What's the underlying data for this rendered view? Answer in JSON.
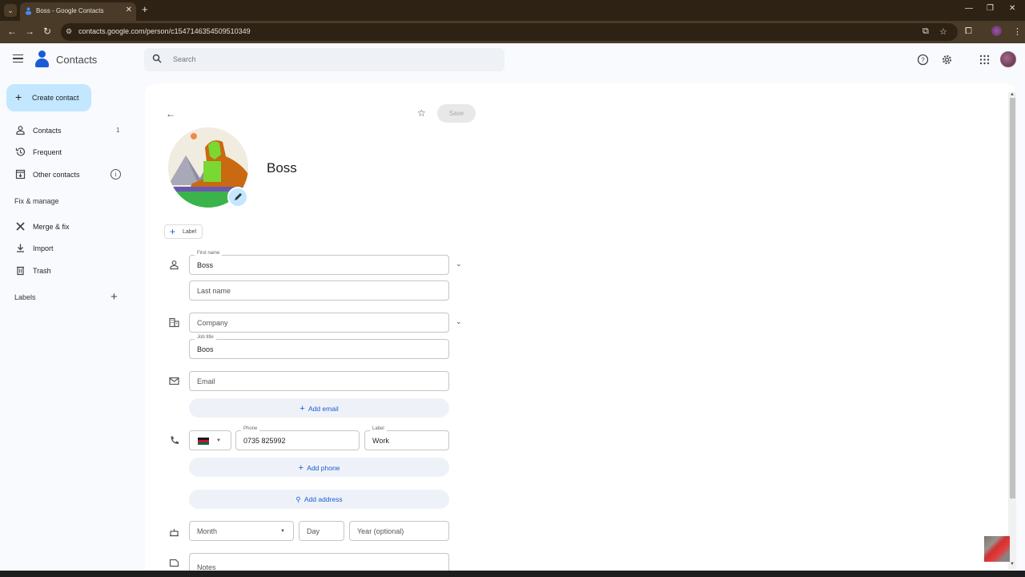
{
  "browser": {
    "tab_title": "Boss - Google Contacts",
    "url": "contacts.google.com/person/c1547146354509510349"
  },
  "header": {
    "app_title": "Contacts",
    "search_placeholder": "Search"
  },
  "sidebar": {
    "create_label": "Create contact",
    "items": [
      {
        "label": "Contacts",
        "count": "1"
      },
      {
        "label": "Frequent"
      },
      {
        "label": "Other contacts"
      }
    ],
    "fix_manage_heading": "Fix & manage",
    "fix_items": [
      {
        "label": "Merge & fix"
      },
      {
        "label": "Import"
      },
      {
        "label": "Trash"
      }
    ],
    "labels_heading": "Labels"
  },
  "contact": {
    "save_label": "Save",
    "name": "Boss",
    "label_button": "Label",
    "fields": {
      "first_name": {
        "label": "First name",
        "value": "Boss"
      },
      "last_name": {
        "placeholder": "Last name"
      },
      "company": {
        "placeholder": "Company"
      },
      "job_title": {
        "label": "Job title",
        "value": "Boos"
      },
      "email": {
        "placeholder": "Email"
      },
      "add_email": "Add email",
      "phone": {
        "label": "Phone",
        "value": "0735 825992",
        "country": "Kenya"
      },
      "phone_label": {
        "label": "Label",
        "value": "Work"
      },
      "add_phone": "Add phone",
      "add_address": "Add address",
      "birthday_month": {
        "placeholder": "Month"
      },
      "birthday_day": {
        "placeholder": "Day"
      },
      "birthday_year": {
        "placeholder": "Year (optional)"
      },
      "notes": {
        "placeholder": "Notes"
      }
    }
  },
  "colors": {
    "accent": "#1a5bd6",
    "create_button_bg": "#c2e7ff",
    "pill_bg": "#eef2f8"
  }
}
